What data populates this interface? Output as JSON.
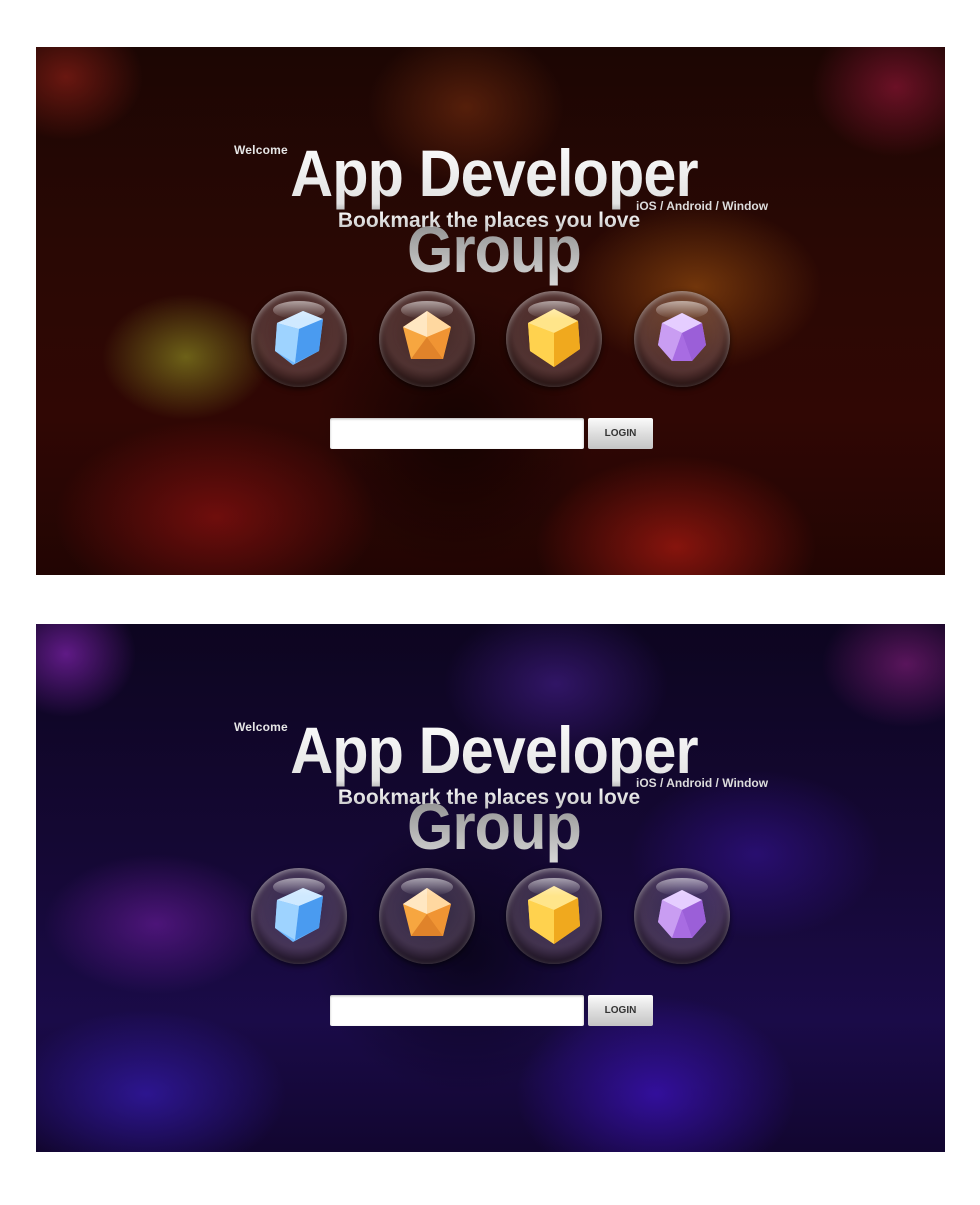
{
  "screens": [
    {
      "theme": "red",
      "welcome": "Welcome",
      "title": "App Developer Group",
      "platforms": "iOS / Android / Window",
      "tagline": "Bookmark the places you love",
      "login_button": "LOGIN"
    },
    {
      "theme": "blue",
      "welcome": "Welcome",
      "title": "App Developer Group",
      "platforms": "iOS / Android / Window",
      "tagline": "Bookmark the places you love",
      "login_button": "LOGIN"
    }
  ],
  "gems": [
    {
      "name": "blue-cube-gem-icon",
      "color": "#7ec4ff"
    },
    {
      "name": "orange-pentagon-gem-icon",
      "color": "#f5a642"
    },
    {
      "name": "yellow-hexagon-gem-icon",
      "color": "#ffc72e"
    },
    {
      "name": "purple-crystal-gem-icon",
      "color": "#b07ae8"
    }
  ]
}
